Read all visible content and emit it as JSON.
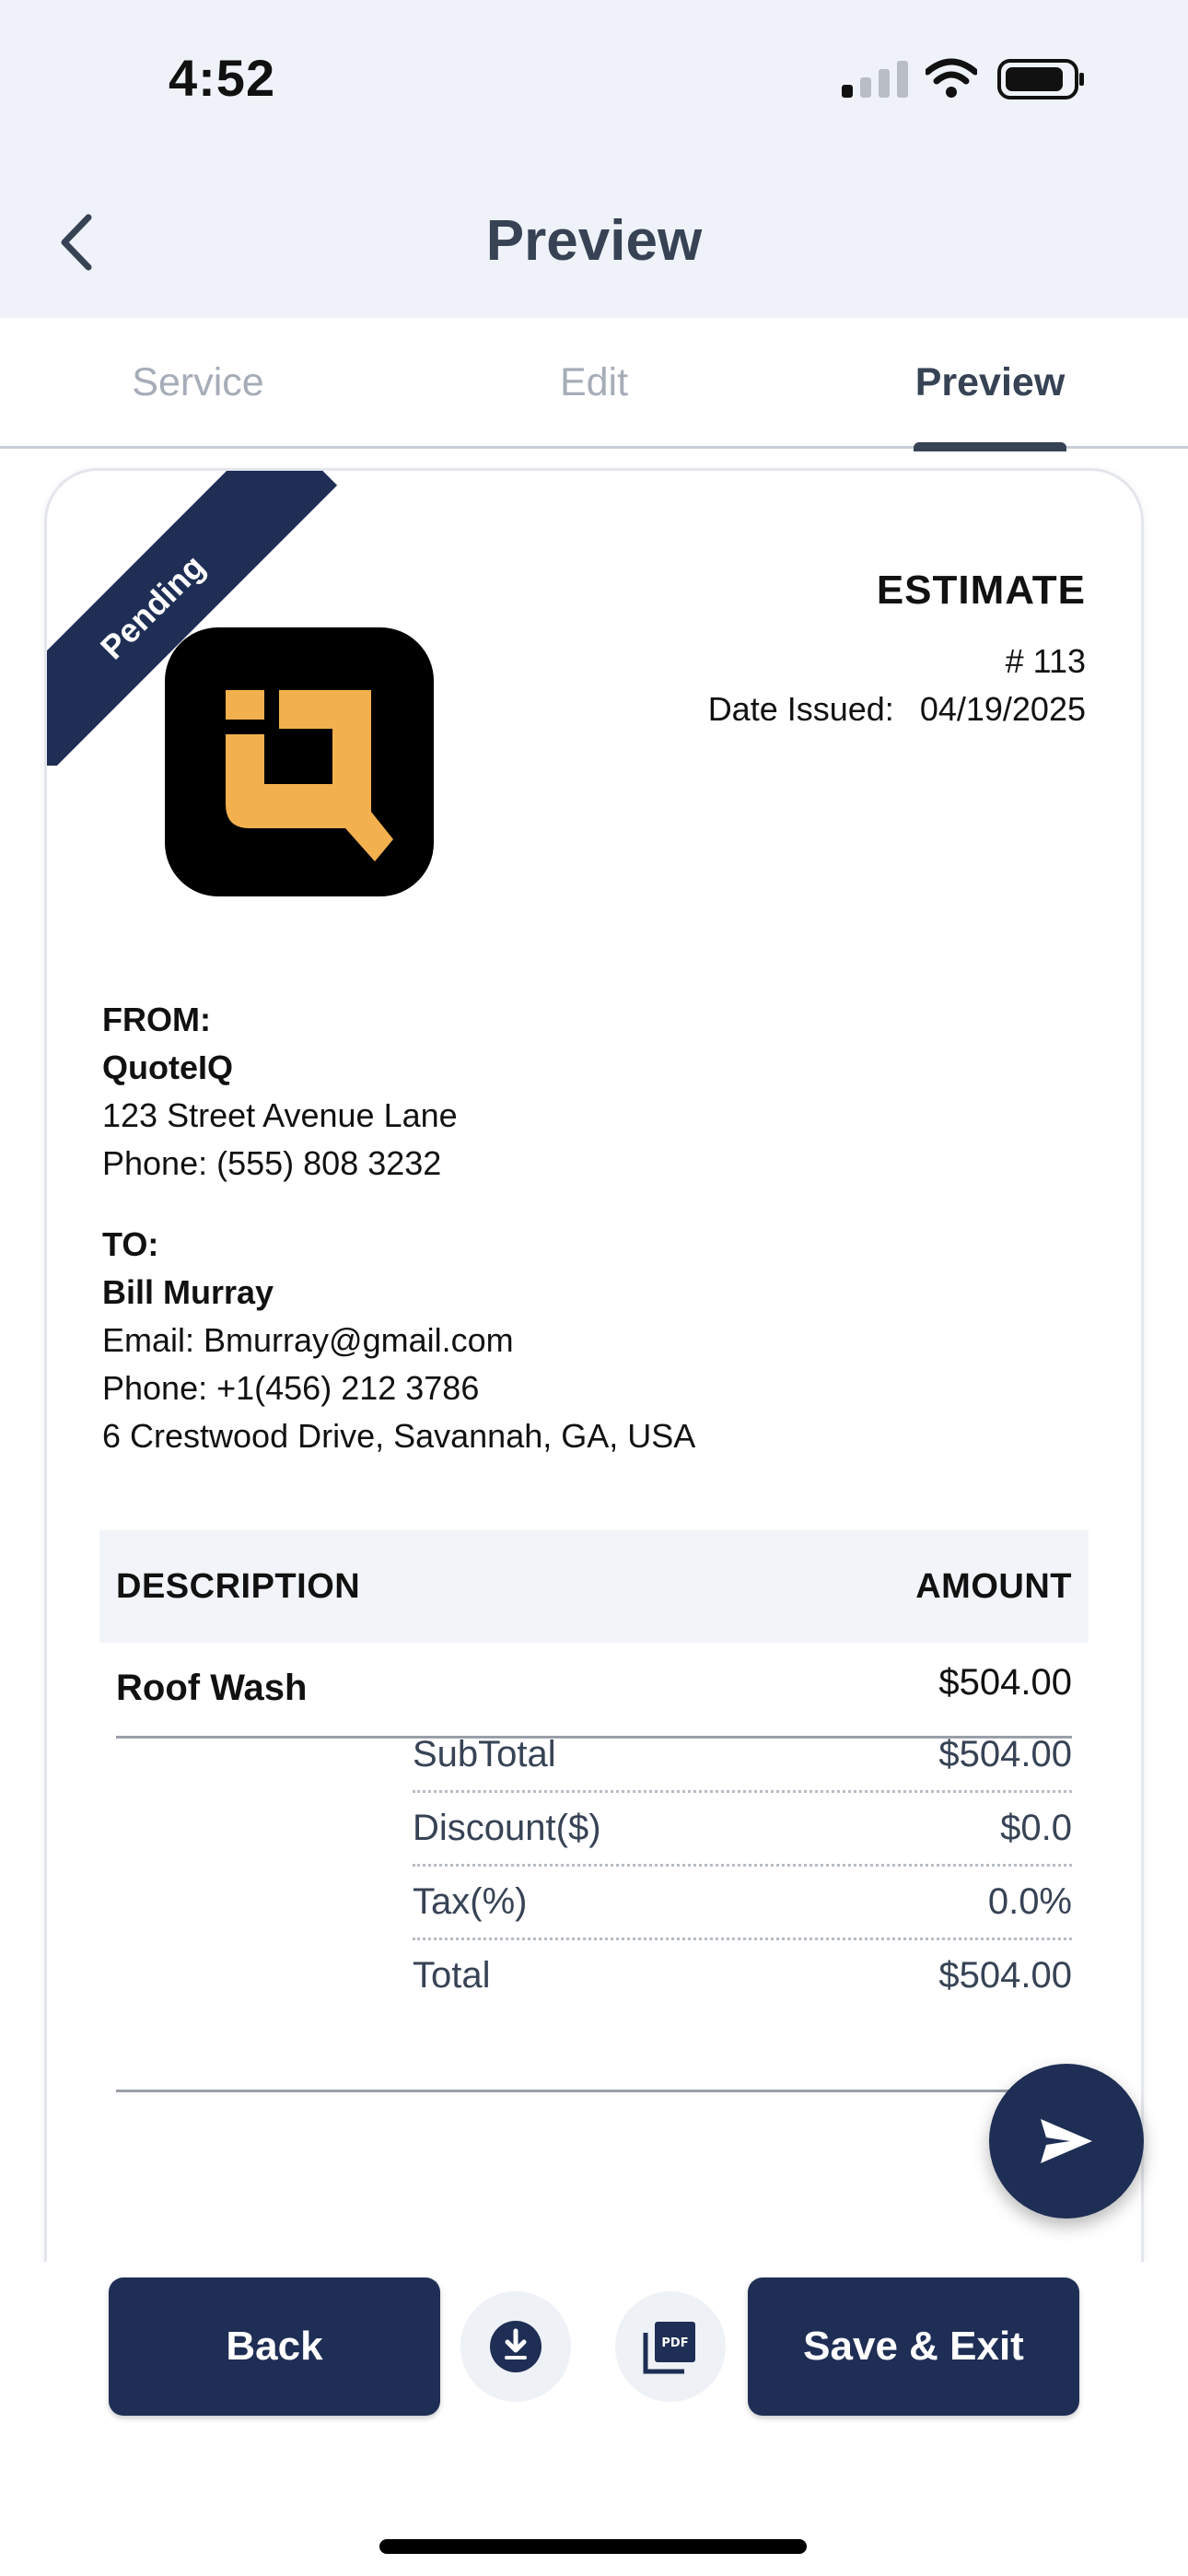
{
  "status_bar": {
    "time": "4:52"
  },
  "header": {
    "title": "Preview",
    "back_icon": "chevron-left-icon"
  },
  "tabs": [
    {
      "label": "Service",
      "active": false
    },
    {
      "label": "Edit",
      "active": false
    },
    {
      "label": "Preview",
      "active": true
    }
  ],
  "document": {
    "status_ribbon": "Pending",
    "title": "ESTIMATE",
    "number": "# 113",
    "date_label": "Date Issued:",
    "date_value": "04/19/2025",
    "from": {
      "label": "FROM:",
      "name": "QuoteIQ",
      "address": "123 Street Avenue Lane",
      "phone": "Phone: (555) 808 3232"
    },
    "to": {
      "label": "TO:",
      "name": "Bill Murray",
      "email": "Email: Bmurray@gmail.com",
      "phone": "Phone: +1(456) 212 3786",
      "address": "6 Crestwood Drive, Savannah, GA, USA"
    },
    "table": {
      "columns": [
        "DESCRIPTION",
        "AMOUNT"
      ],
      "rows": [
        {
          "description": "Roof Wash",
          "amount": "$504.00"
        }
      ]
    },
    "summary": {
      "subtotal_label": "SubTotal",
      "subtotal_value": "$504.00",
      "discount_label": "Discount($)",
      "discount_value": "$0.0",
      "tax_label": "Tax(%)",
      "tax_value": "0.0%",
      "total_label": "Total",
      "total_value": "$504.00"
    }
  },
  "actions": {
    "back_label": "Back",
    "save_label": "Save & Exit",
    "download_icon": "download-icon",
    "pdf_icon": "pdf-icon",
    "send_icon": "send-icon"
  },
  "colors": {
    "navy": "#1f2e55",
    "header_bg": "#eff3f9",
    "slate_text": "#374355",
    "logo_orange": "#f2b04e"
  }
}
